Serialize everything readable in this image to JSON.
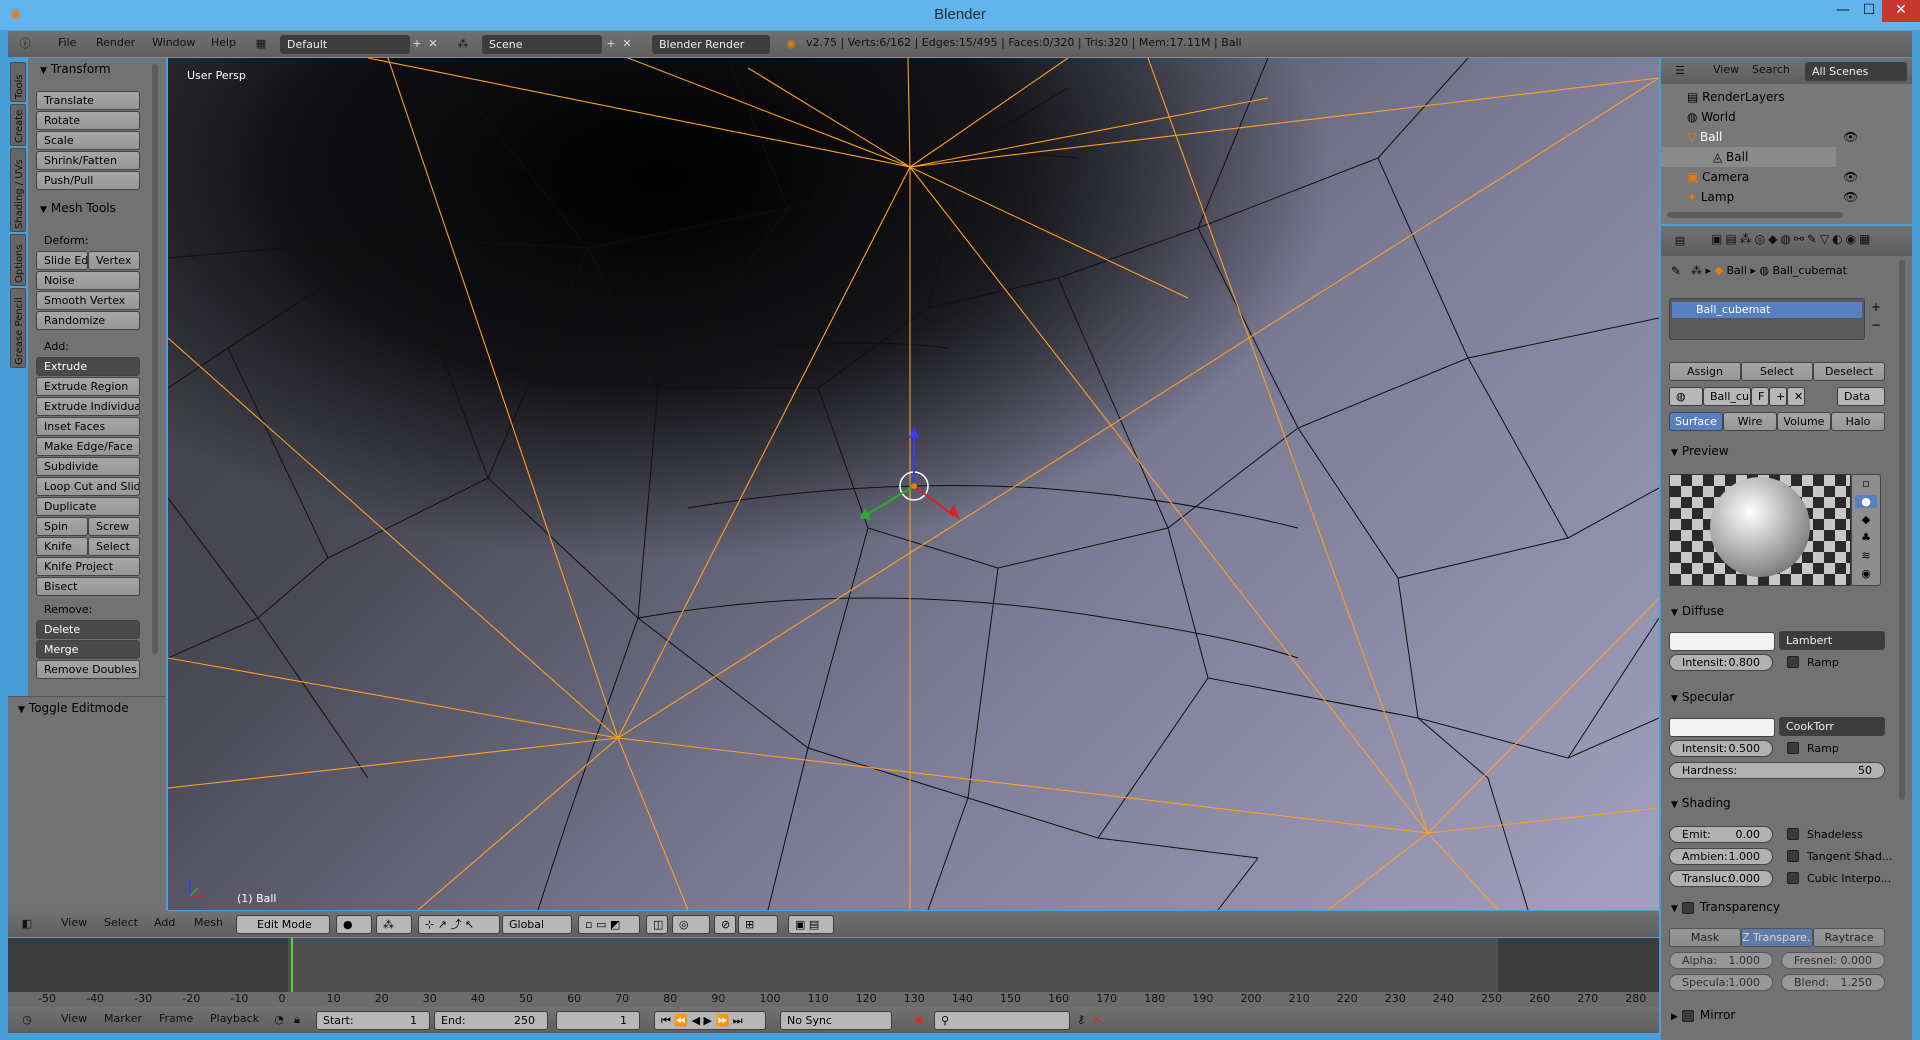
{
  "window": {
    "title": "Blender",
    "min": "—",
    "max": "☐",
    "close": "✕"
  },
  "info_header": {
    "menus": [
      "File",
      "Render",
      "Window",
      "Help"
    ],
    "layout": "Default",
    "scene": "Scene",
    "engine": "Blender Render",
    "stats": "v2.75 | Verts:6/162 | Edges:15/495 | Faces:0/320 | Tris:320 | Mem:17.11M | Ball"
  },
  "tool_tabs": [
    "Tools",
    "Create",
    "Shading / UVs",
    "Options",
    "Grease Pencil"
  ],
  "tools": {
    "transform_header": "Transform",
    "transform": [
      "Translate",
      "Rotate",
      "Scale",
      "Shrink/Fatten",
      "Push/Pull"
    ],
    "mesh_tools_header": "Mesh Tools",
    "deform_label": "Deform:",
    "slide_edge": "Slide Ed",
    "vertex": "Vertex",
    "noise": "Noise",
    "smooth_vertex": "Smooth Vertex",
    "randomize": "Randomize",
    "add_label": "Add:",
    "extrude": "Extrude",
    "add_tools": [
      "Extrude Region",
      "Extrude Individual",
      "Inset Faces",
      "Make Edge/Face",
      "Subdivide",
      "Loop Cut and Slide",
      "Duplicate"
    ],
    "spin": "Spin",
    "screw": "Screw",
    "knife": "Knife",
    "select": "Select",
    "knife_project": "Knife Project",
    "bisect": "Bisect",
    "remove_label": "Remove:",
    "delete": "Delete",
    "merge": "Merge",
    "remove_doubles": "Remove Doubles",
    "toggle_editmode": "Toggle Editmode"
  },
  "viewport": {
    "view_label": "User Persp",
    "object_label": "(1) Ball"
  },
  "view3d_header": {
    "menus": [
      "View",
      "Select",
      "Add",
      "Mesh"
    ],
    "mode": "Edit Mode",
    "orientation": "Global"
  },
  "timeline": {
    "ruler": [
      "-50",
      "-40",
      "-30",
      "-20",
      "-10",
      "0",
      "10",
      "20",
      "30",
      "40",
      "50",
      "60",
      "70",
      "80",
      "90",
      "100",
      "110",
      "120",
      "130",
      "140",
      "150",
      "160",
      "170",
      "180",
      "190",
      "200",
      "210",
      "220",
      "230",
      "240",
      "250",
      "260",
      "270",
      "280"
    ],
    "current_frame_value": 0,
    "menus": [
      "View",
      "Marker",
      "Frame",
      "Playback"
    ],
    "start_label": "Start:",
    "start": "1",
    "end_label": "End:",
    "end": "250",
    "current": "1",
    "sync": "No Sync"
  },
  "outliner": {
    "menus": [
      "View",
      "Search"
    ],
    "filter": "All Scenes",
    "items": [
      "RenderLayers",
      "World",
      "Ball",
      "Ball",
      "Camera",
      "Lamp"
    ]
  },
  "properties": {
    "breadcrumb_object": "Ball",
    "breadcrumb_material": "Ball_cubemat",
    "material_slot": "Ball_cubemat",
    "assign": "Assign",
    "select": "Select",
    "deselect": "Deselect",
    "mat_name": "Ball_cu",
    "fake_user": "F",
    "link": "Data",
    "tabs": [
      "Surface",
      "Wire",
      "Volume",
      "Halo"
    ],
    "preview_header": "Preview",
    "diffuse_header": "Diffuse",
    "diffuse_shader": "Lambert",
    "diffuse_intensity_label": "Intensit:",
    "diffuse_intensity": "0.800",
    "ramp": "Ramp",
    "specular_header": "Specular",
    "specular_shader": "CookTorr",
    "specular_intensity_label": "Intensit:",
    "specular_intensity": "0.500",
    "hardness_label": "Hardness:",
    "hardness": "50",
    "shading_header": "Shading",
    "emit_label": "Emit:",
    "emit": "0.00",
    "ambient_label": "Ambien:",
    "ambient": "1.000",
    "transluc_label": "Transluc:",
    "transluc": "0.000",
    "shadeless": "Shadeless",
    "tangent": "Tangent Shad...",
    "cubic": "Cubic Interpo...",
    "transparency_header": "Transparency",
    "trans_tabs": [
      "Mask",
      "Z Transpare...",
      "Raytrace"
    ],
    "alpha_label": "Alpha:",
    "alpha": "1.000",
    "fresnel_label": "Fresnel:",
    "fresnel": "0.000",
    "specula_label": "Specula:",
    "specula": "1.000",
    "blend_label": "Blend:",
    "blend": "1.250",
    "mirror_header": "Mirror"
  }
}
